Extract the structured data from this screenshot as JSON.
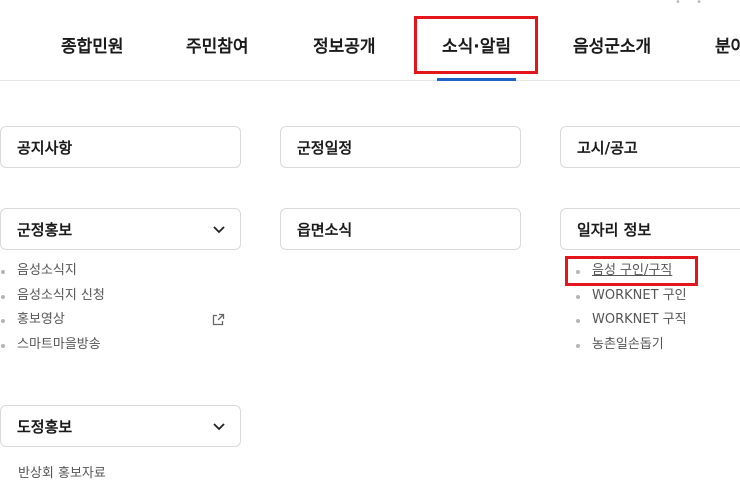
{
  "nav": {
    "items": [
      "종합민원",
      "주민참여",
      "정보공개",
      "소식·알림",
      "음성군소개",
      "분야"
    ],
    "active": "소식·알림"
  },
  "menu": {
    "col1": {
      "notice": "공지사항",
      "promo": "군정홍보",
      "promo_items": [
        "음성소식지",
        "음성소식지 신청",
        "홍보영상",
        "스마트마을방송"
      ],
      "province": "도정홍보",
      "province_items": [
        "반상회 홍보자료"
      ]
    },
    "col2": {
      "schedule": "군정일정",
      "town_news": "읍면소식"
    },
    "col3": {
      "gosi": "고시/공고",
      "jobs": "일자리 정보",
      "jobs_items": [
        "음성 구인/구직",
        "WORKNET 구인",
        "WORKNET 구직",
        "농촌일손돕기"
      ]
    }
  },
  "colors": {
    "highlight": "#e3161b",
    "accent": "#1e63c8"
  },
  "icons": [
    "chevron-down-icon",
    "external-link-icon"
  ]
}
